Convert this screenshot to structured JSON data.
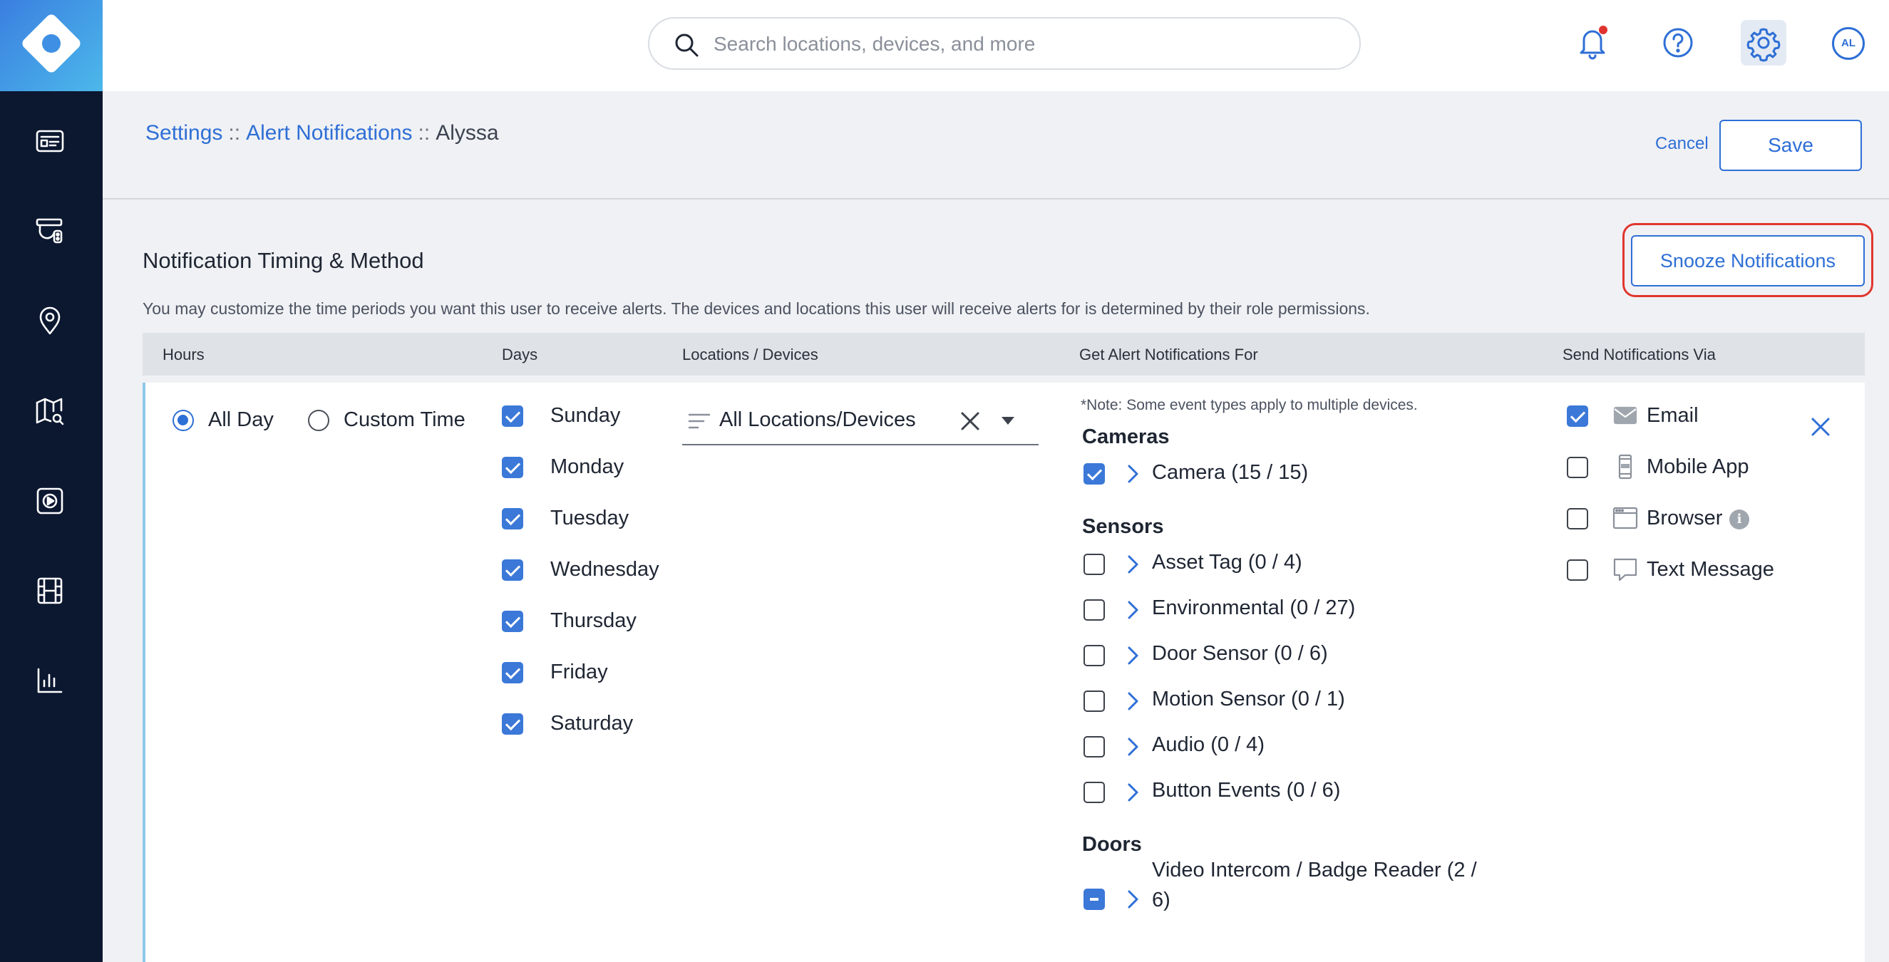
{
  "header": {
    "search_placeholder": "Search locations, devices, and more",
    "avatar_initials": "AL"
  },
  "breadcrumb": {
    "settings": "Settings",
    "separator": "::",
    "alert_notifications": "Alert Notifications",
    "current": "Alyssa"
  },
  "actions": {
    "cancel": "Cancel",
    "save": "Save",
    "snooze": "Snooze Notifications"
  },
  "section": {
    "title": "Notification Timing & Method",
    "description": "You may customize the time periods you want this user to receive alerts. The devices and locations this user will receive alerts for is determined by their role permissions."
  },
  "table": {
    "columns": {
      "hours": "Hours",
      "days": "Days",
      "locations": "Locations / Devices",
      "alerts": "Get Alert Notifications For",
      "send_via": "Send Notifications Via"
    }
  },
  "hours": {
    "all_day": "All Day",
    "custom_time": "Custom Time",
    "selected": "All Day"
  },
  "days": [
    {
      "label": "Sunday",
      "checked": true
    },
    {
      "label": "Monday",
      "checked": true
    },
    {
      "label": "Tuesday",
      "checked": true
    },
    {
      "label": "Wednesday",
      "checked": true
    },
    {
      "label": "Thursday",
      "checked": true
    },
    {
      "label": "Friday",
      "checked": true
    },
    {
      "label": "Saturday",
      "checked": true
    }
  ],
  "locations": {
    "value": "All Locations/Devices"
  },
  "alerts": {
    "note": "*Note: Some event types apply to multiple devices.",
    "cameras": {
      "title": "Cameras",
      "items": [
        {
          "label": "Camera (15 / 15)",
          "state": "checked"
        }
      ]
    },
    "sensors": {
      "title": "Sensors",
      "items": [
        {
          "label": "Asset Tag (0 / 4)",
          "state": "unchecked"
        },
        {
          "label": "Environmental (0 / 27)",
          "state": "unchecked"
        },
        {
          "label": "Door Sensor (0 / 6)",
          "state": "unchecked"
        },
        {
          "label": "Motion Sensor (0 / 1)",
          "state": "unchecked"
        },
        {
          "label": "Audio (0 / 4)",
          "state": "unchecked"
        },
        {
          "label": "Button Events (0 / 6)",
          "state": "unchecked"
        }
      ]
    },
    "doors": {
      "title": "Doors",
      "items": [
        {
          "label_line1": "Video Intercom / Badge Reader (2 /",
          "label_line2": "6)",
          "state": "indeterminate"
        }
      ]
    }
  },
  "send_via": [
    {
      "label": "Email",
      "icon": "email-icon",
      "checked": true
    },
    {
      "label": "Mobile App",
      "icon": "mobile-icon",
      "checked": false
    },
    {
      "label": "Browser",
      "icon": "browser-icon",
      "checked": false
    },
    {
      "label": "Text Message",
      "icon": "text-message-icon",
      "checked": false
    }
  ],
  "colors": {
    "accent": "#2e6fd6",
    "sidebar": "#0c1730",
    "highlight_ring": "#e0372f",
    "notification_dot": "#e0322f"
  }
}
